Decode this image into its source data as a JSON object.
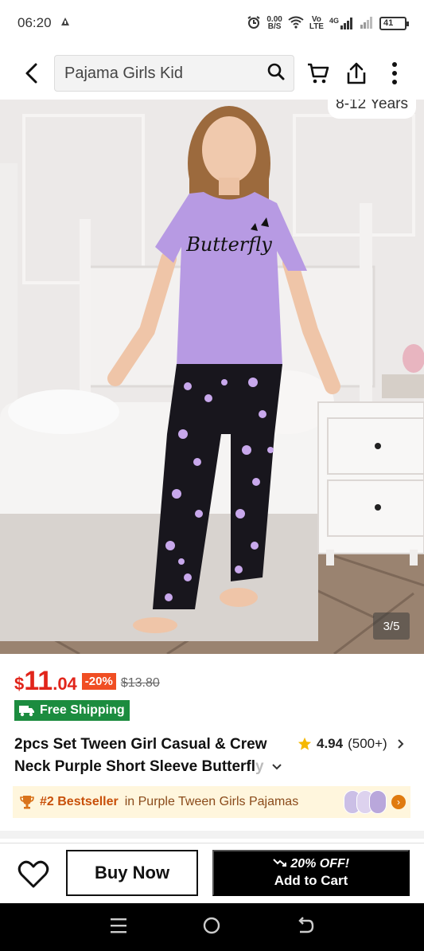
{
  "status_bar": {
    "time": "06:20",
    "net_speed": "0.00",
    "net_unit": "B/S",
    "volte_top": "Vo",
    "volte_bottom": "LTE",
    "network": "4G",
    "battery": "41"
  },
  "header": {
    "search_text": "Pajama Girls Kid"
  },
  "gallery": {
    "age_tag": "8-12 Years",
    "pager": "3/5",
    "shirt_print": "Butterfly"
  },
  "product": {
    "currency": "$",
    "price_int": "11",
    "price_dec": ".04",
    "discount": "-20%",
    "old_price": "$13.80",
    "free_shipping": "Free Shipping",
    "title_line1": "2pcs Set Tween Girl Casual & Crew",
    "title_line2": "Neck Purple Short Sleeve Butterfl",
    "title_fade": "y",
    "rating": "4.94",
    "reviews": "(500+)",
    "bestseller_rank": "#2 Bestseller",
    "bestseller_category": "in Purple Tween Girls Pajamas"
  },
  "actions": {
    "buy_now": "Buy Now",
    "cart_promo": "20% OFF!",
    "add_to_cart": "Add to Cart"
  },
  "colors": {
    "price_red": "#e1251b",
    "discount_orange": "#f04e23",
    "shipping_green": "#1c8c3f",
    "banner_bg": "#fff6dd"
  }
}
